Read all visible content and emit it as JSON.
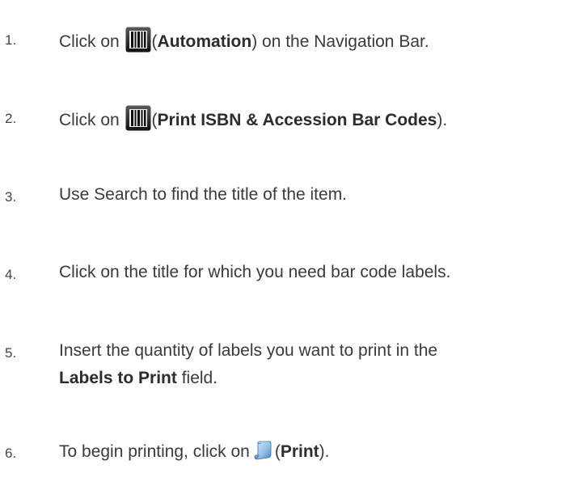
{
  "steps": [
    {
      "number": "1.",
      "prefix": "Click on",
      "icon": "barcode-icon",
      "open_paren": "(",
      "bold": "Automation",
      "suffix": ") on the Navigation Bar."
    },
    {
      "number": "2.",
      "prefix": "Click on",
      "icon": "barcode-icon",
      "open_paren": "(",
      "bold": "Print ISBN & Accession Bar Codes",
      "suffix": ")."
    },
    {
      "number": "3.",
      "text": "Use Search to find the title of the item."
    },
    {
      "number": "4.",
      "text": "Click on the title for which you need bar code labels."
    },
    {
      "number": "5.",
      "text": "Insert the quantity of labels you want to print in the",
      "bold": "Labels to Print",
      "suffix": " field."
    },
    {
      "number": "6.",
      "prefix": "To begin printing, click on",
      "icon": "print-scroll-icon",
      "open_paren": "(",
      "bold": "Print",
      "suffix": ")."
    }
  ]
}
